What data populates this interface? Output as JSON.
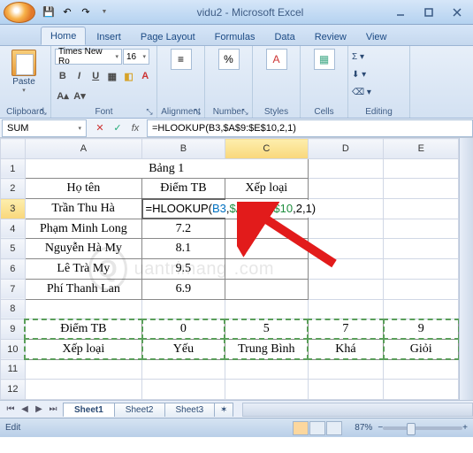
{
  "title": "vidu2 - Microsoft Excel",
  "tabs": [
    "Home",
    "Insert",
    "Page Layout",
    "Formulas",
    "Data",
    "Review",
    "View"
  ],
  "active_tab": 0,
  "ribbon": {
    "clipboard": {
      "label": "Clipboard",
      "paste": "Paste"
    },
    "font": {
      "label": "Font",
      "name": "Times New Ro",
      "size": "16"
    },
    "alignment": {
      "label": "Alignment"
    },
    "number": {
      "label": "Number"
    },
    "styles": {
      "label": "Styles"
    },
    "cells": {
      "label": "Cells"
    },
    "editing": {
      "label": "Editing"
    }
  },
  "namebox": "SUM",
  "formula_bar": "=HLOOKUP(B3,$A$9:$E$10,2,1)",
  "columns": [
    "A",
    "B",
    "C",
    "D",
    "E"
  ],
  "rows": [
    "1",
    "2",
    "3",
    "4",
    "5",
    "6",
    "7",
    "8",
    "9",
    "10",
    "11",
    "12"
  ],
  "cells": {
    "A1": "Bảng 1",
    "A2": "Họ tên",
    "B2": "Điểm TB",
    "C2": "Xếp loại",
    "A3": "Trần Thu Hà",
    "B3_formula_start": "=HLOOKUP(",
    "B3_ref": "B3",
    "B3_sep1": ",",
    "B3_range": "$A$9:$E$10",
    "B3_rest": ",2,1)",
    "A4": "Phạm Minh Long",
    "B4": "7.2",
    "A5": "Nguyễn Hà My",
    "B5": "8.1",
    "A6": "Lê Trà My",
    "B6": "9.5",
    "A7": "Phí Thanh Lan",
    "B7": "6.9",
    "A9": "Điểm TB",
    "B9": "0",
    "C9": "5",
    "D9": "7",
    "E9": "9",
    "A10": "Xếp loại",
    "B10": "Yếu",
    "C10": "Trung Bình",
    "D10": "Khá",
    "E10": "Giỏi"
  },
  "sheets": [
    "Sheet1",
    "Sheet2",
    "Sheet3"
  ],
  "active_sheet": 0,
  "status": "Edit",
  "zoom": "87%",
  "watermark": "uantrimang"
}
